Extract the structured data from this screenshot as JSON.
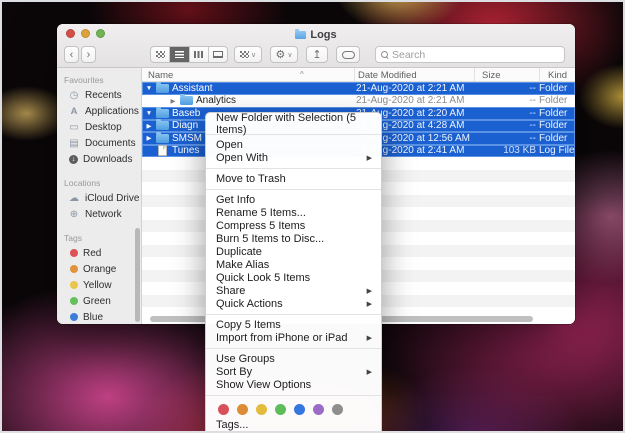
{
  "window": {
    "title": "Logs"
  },
  "toolbar": {
    "back_glyph": "‹",
    "forward_glyph": "›",
    "view_modes": [
      "icon-view",
      "list-view",
      "column-view",
      "gallery-view"
    ],
    "active_view": "list-view",
    "chevron_glyph": "∨",
    "gear_glyph": "⚙",
    "share_glyph": "↥",
    "search_placeholder": "Search"
  },
  "sidebar": {
    "sections": [
      {
        "title": "Favourites",
        "items": [
          {
            "icon": "recents-icon",
            "glyph": "◷",
            "label": "Recents"
          },
          {
            "icon": "applications-icon",
            "glyph": "A",
            "label": "Applications"
          },
          {
            "icon": "desktop-icon",
            "glyph": "▭",
            "label": "Desktop"
          },
          {
            "icon": "documents-icon",
            "glyph": "▤",
            "label": "Documents"
          },
          {
            "icon": "downloads-icon",
            "glyph": "↓",
            "label": "Downloads"
          }
        ]
      },
      {
        "title": "Locations",
        "items": [
          {
            "icon": "icloud-drive-icon",
            "glyph": "☁",
            "label": "iCloud Drive"
          },
          {
            "icon": "network-icon",
            "glyph": "⊕",
            "label": "Network"
          }
        ]
      },
      {
        "title": "Tags",
        "items": [
          {
            "icon": "red-tag-dot",
            "color": "#dd5257",
            "label": "Red"
          },
          {
            "icon": "orange-tag-dot",
            "color": "#e2923b",
            "label": "Orange"
          },
          {
            "icon": "yellow-tag-dot",
            "color": "#eac54b",
            "label": "Yellow"
          },
          {
            "icon": "green-tag-dot",
            "color": "#63c15b",
            "label": "Green"
          },
          {
            "icon": "blue-tag-dot",
            "color": "#3d7edb",
            "label": "Blue"
          }
        ]
      }
    ]
  },
  "list": {
    "columns": [
      "Name",
      "Date Modified",
      "Size",
      "Kind"
    ],
    "sort_caret": "^",
    "collapsed_glyph": "▶",
    "expanded_glyph": "▼",
    "rows": [
      {
        "name": "Assistant",
        "date": "21-Aug-2020 at 2:21 AM",
        "size": "--",
        "kind": "Folder",
        "selected": true,
        "expanded": true,
        "level": 0,
        "type": "folder"
      },
      {
        "name": "Analytics",
        "date": "21-Aug-2020 at 2:21 AM",
        "size": "--",
        "kind": "Folder",
        "selected": false,
        "expanded": false,
        "level": 1,
        "type": "folder"
      },
      {
        "name": "Baseb",
        "date": "21-Aug-2020 at 2:20 AM",
        "size": "--",
        "kind": "Folder",
        "selected": true,
        "expanded": true,
        "level": 0,
        "type": "folder"
      },
      {
        "name": "Diagn",
        "date": "21-Aug-2020 at 4:28 AM",
        "size": "--",
        "kind": "Folder",
        "selected": true,
        "expanded": false,
        "level": 0,
        "type": "folder"
      },
      {
        "name": "SMSM",
        "date": "21-Aug-2020 at 12:56 AM",
        "size": "--",
        "kind": "Folder",
        "selected": true,
        "expanded": false,
        "level": 0,
        "type": "folder"
      },
      {
        "name": "Tunes",
        "date": "21-Aug-2020 at 2:41 AM",
        "size": "103 KB",
        "kind": "Log File",
        "selected": true,
        "level": 0,
        "type": "file"
      }
    ]
  },
  "menu": {
    "arrow_glyph": "▶",
    "items": [
      {
        "label": "New Folder with Selection (5 Items)",
        "submenu": false
      },
      {
        "label": "Open",
        "submenu": false
      },
      {
        "label": "Open With",
        "submenu": true
      },
      {
        "label": "Move to Trash",
        "submenu": false
      },
      {
        "label": "Get Info",
        "submenu": false
      },
      {
        "label": "Rename 5 Items...",
        "submenu": false
      },
      {
        "label": "Compress 5 Items",
        "submenu": false
      },
      {
        "label": "Burn 5 Items to Disc...",
        "submenu": false
      },
      {
        "label": "Duplicate",
        "submenu": false
      },
      {
        "label": "Make Alias",
        "submenu": false
      },
      {
        "label": "Quick Look 5 Items",
        "submenu": false
      },
      {
        "label": "Share",
        "submenu": true
      },
      {
        "label": "Quick Actions",
        "submenu": true
      },
      {
        "label": "Copy 5 Items",
        "submenu": false
      },
      {
        "label": "Import from iPhone or iPad",
        "submenu": true
      },
      {
        "label": "Use Groups",
        "submenu": false
      },
      {
        "label": "Sort By",
        "submenu": true
      },
      {
        "label": "Show View Options",
        "submenu": false
      }
    ],
    "tag_colors": [
      "#d8515a",
      "#dd8c35",
      "#e3bc3e",
      "#5dbd5a",
      "#3477de",
      "#9b6bc8",
      "#8e8e8e"
    ],
    "tags_label": "Tags..."
  }
}
